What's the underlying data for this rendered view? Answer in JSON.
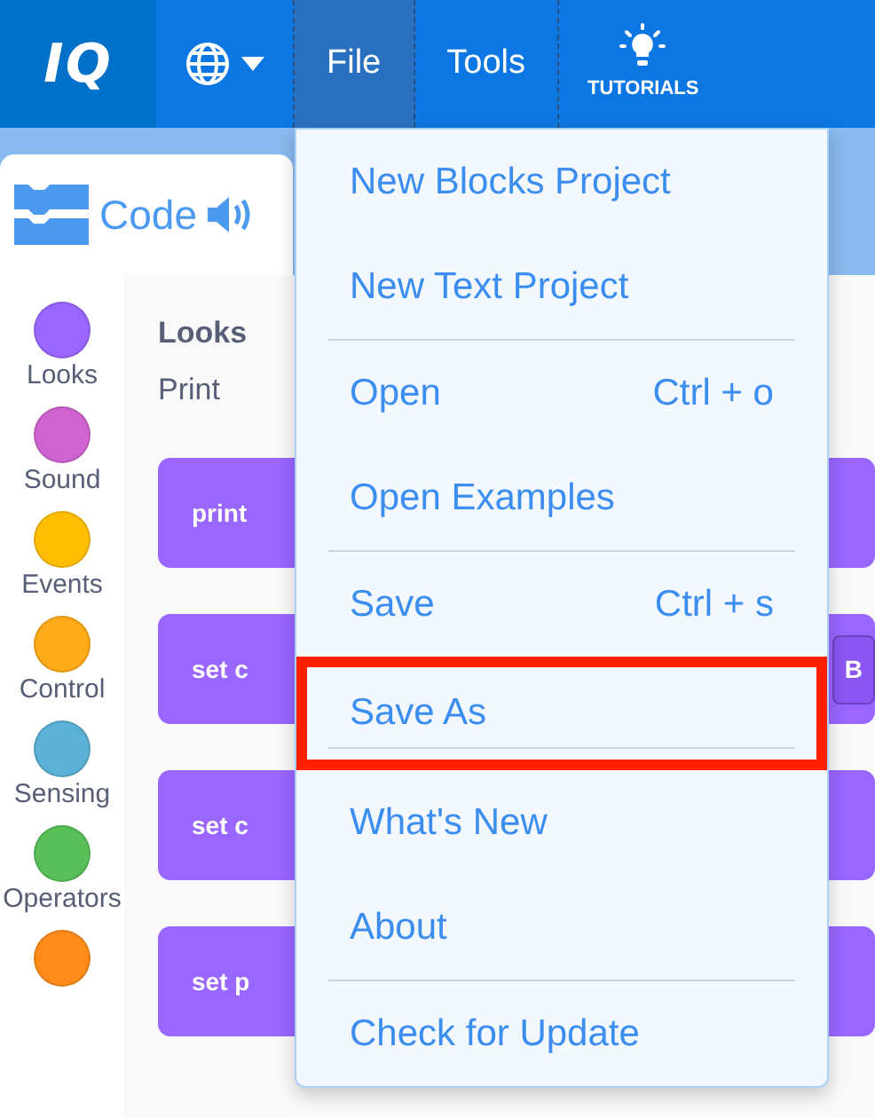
{
  "navbar": {
    "logo": "IQ",
    "items": [
      {
        "label": "File",
        "selected": true
      },
      {
        "label": "Tools",
        "selected": false
      }
    ],
    "tutorials": "TUTORIALS"
  },
  "tab": {
    "label": "Code"
  },
  "categories": [
    {
      "label": "Looks",
      "color": "#9966ff"
    },
    {
      "label": "Sound",
      "color": "#cf63cf"
    },
    {
      "label": "Events",
      "color": "#ffbf00"
    },
    {
      "label": "Control",
      "color": "#ffab19"
    },
    {
      "label": "Sensing",
      "color": "#5cb1d6"
    },
    {
      "label": "Operators",
      "color": "#59c059"
    },
    {
      "color": "#ff8c1a"
    }
  ],
  "palette": {
    "heading": "Looks",
    "subheading": "Print",
    "blocks": [
      {
        "label": "print"
      },
      {
        "label": "set c",
        "tail": "B"
      },
      {
        "label": "set c"
      },
      {
        "label": "set p"
      }
    ]
  },
  "file_menu": {
    "items": [
      {
        "label": "New Blocks Project",
        "highlighted": false,
        "divider_after": false
      },
      {
        "label": "New Text Project",
        "highlighted": false,
        "divider_after": true
      },
      {
        "label": "Open",
        "shortcut": "Ctrl + o",
        "highlighted": false,
        "divider_after": false
      },
      {
        "label": "Open Examples",
        "highlighted": false,
        "divider_after": true
      },
      {
        "label": "Save",
        "shortcut": "Ctrl + s",
        "highlighted": false,
        "divider_after": false
      },
      {
        "label": "Save As",
        "highlighted": true,
        "divider_after": true
      },
      {
        "label": "What's New",
        "highlighted": false,
        "divider_after": false
      },
      {
        "label": "About",
        "highlighted": false,
        "divider_after": true
      },
      {
        "label": "Check for Update",
        "highlighted": false,
        "divider_after": false
      }
    ]
  }
}
